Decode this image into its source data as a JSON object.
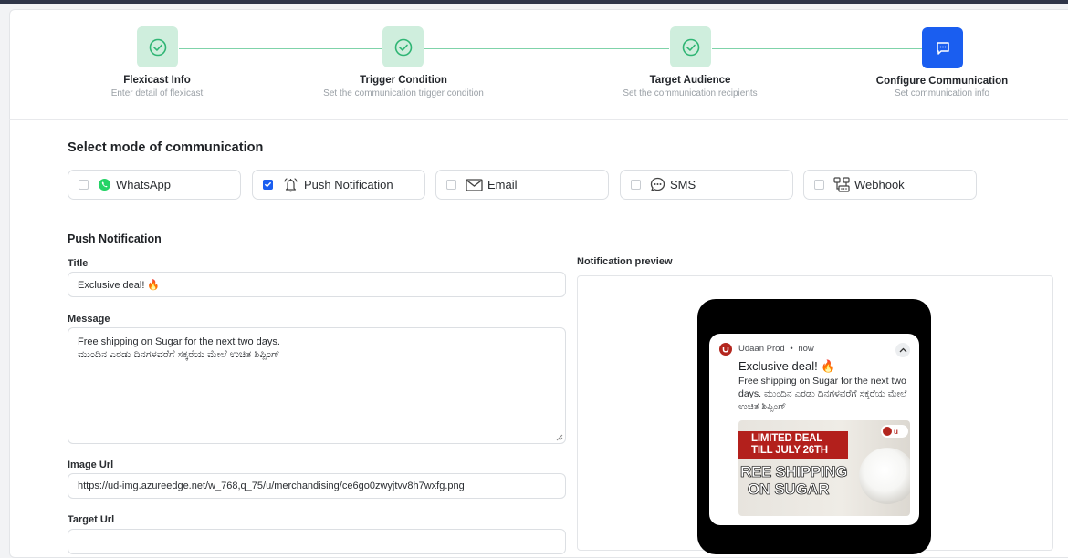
{
  "stepper": {
    "steps": [
      {
        "title": "Flexicast Info",
        "subtitle": "Enter detail of flexicast",
        "status": "done",
        "icon": "check-icon"
      },
      {
        "title": "Trigger Condition",
        "subtitle": "Set the communication trigger condition",
        "status": "done",
        "icon": "check-icon"
      },
      {
        "title": "Target Audience",
        "subtitle": "Set the communication recipients",
        "status": "done",
        "icon": "check-icon"
      },
      {
        "title": "Configure Communication",
        "subtitle": "Set communication info",
        "status": "active",
        "icon": "chat-icon"
      }
    ]
  },
  "mode": {
    "heading": "Select mode of communication",
    "options": [
      {
        "label": "WhatsApp",
        "checked": false,
        "icon": "whatsapp-icon"
      },
      {
        "label": "Push Notification",
        "checked": true,
        "icon": "bell-icon"
      },
      {
        "label": "Email",
        "checked": false,
        "icon": "mail-icon"
      },
      {
        "label": "SMS",
        "checked": false,
        "icon": "sms-icon"
      },
      {
        "label": "Webhook",
        "checked": false,
        "icon": "webhook-icon"
      }
    ]
  },
  "push": {
    "heading": "Push Notification",
    "title_label": "Title",
    "title_value": "Exclusive deal! 🔥",
    "message_label": "Message",
    "message_line1": "Free shipping on Sugar for the next two days.",
    "message_line2": "ಮುಂದಿನ ಎರಡು ದಿನಗಳವರೆಗೆ ಸಕ್ಕರೆಯ ಮೇಲೆ ಉಚಿತ ಶಿಪ್ಪಿಂಗ್",
    "image_url_label": "Image Url",
    "image_url_value": "https://ud-img.azureedge.net/w_768,q_75/u/merchandising/ce6go0zwyjtvv8h7wxfg.png",
    "target_url_label": "Target Url"
  },
  "preview": {
    "label": "Notification preview",
    "app_name": "Udaan Prod",
    "separator": "•",
    "time": "now",
    "title": "Exclusive deal! 🔥",
    "body": "Free shipping on Sugar for the next two days. ಮುಂದಿನ ಎರಡು ದಿನಗಳವರೆಗೆ ಸಕ್ಕರೆಯ ಮೇಲೆ ಉಚಿತ ಶಿಪ್ಪಿಂಗ್",
    "banner_line1": "LIMITED DEAL",
    "banner_line2": "TILL JULY 26TH",
    "banner_main1": "REE SHIPPING",
    "banner_main2": "ON SUGAR",
    "banner_logo": "u"
  },
  "colors": {
    "accent": "#1a5ef0",
    "done": "#cfeedd",
    "done_icon": "#2fb574",
    "banner_red": "#b3201c"
  }
}
